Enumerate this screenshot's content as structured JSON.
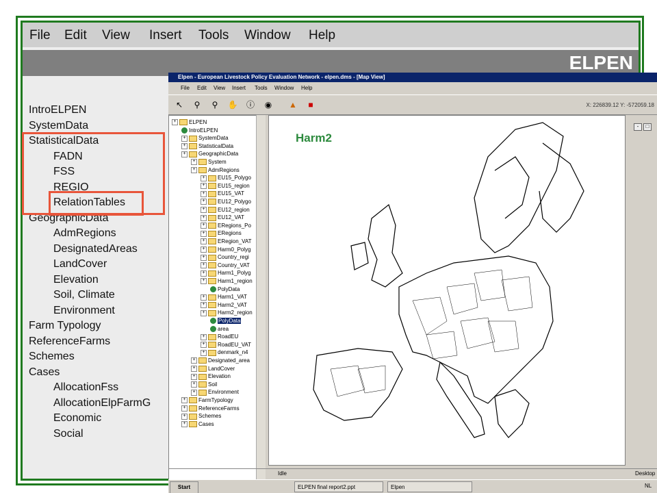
{
  "menubar": {
    "items": [
      "File",
      "Edit",
      "View",
      "Insert",
      "Tools",
      "Window",
      "Help"
    ]
  },
  "header": {
    "brand": "ELPEN"
  },
  "outline": {
    "items": [
      {
        "label": "IntroELPEN",
        "indent": 0
      },
      {
        "label": "SystemData",
        "indent": 0
      },
      {
        "label": "StatisticalData",
        "indent": 0
      },
      {
        "label": "FADN",
        "indent": 1
      },
      {
        "label": "FSS",
        "indent": 1
      },
      {
        "label": "REGIO",
        "indent": 1
      },
      {
        "label": "RelationTables",
        "indent": 1
      },
      {
        "label": "GeographicData",
        "indent": 0
      },
      {
        "label": "AdmRegions",
        "indent": 1
      },
      {
        "label": "DesignatedAreas",
        "indent": 1
      },
      {
        "label": "LandCover",
        "indent": 1
      },
      {
        "label": "Elevation",
        "indent": 1
      },
      {
        "label": "Soil, Climate",
        "indent": 1
      },
      {
        "label": "Environment",
        "indent": 1
      },
      {
        "label": "Farm Typology",
        "indent": 0
      },
      {
        "label": "ReferenceFarms",
        "indent": 0
      },
      {
        "label": "Schemes",
        "indent": 0
      },
      {
        "label": "Cases",
        "indent": 0
      },
      {
        "label": "AllocationFss",
        "indent": 1
      },
      {
        "label": "AllocationElpFarmG",
        "indent": 1
      },
      {
        "label": "Economic",
        "indent": 1
      },
      {
        "label": "Social",
        "indent": 1
      }
    ]
  },
  "app": {
    "title": "Elpen - European Livestock Policy Evaluation Network - elpen.dms - [Map View]",
    "menu": [
      "File",
      "Edit",
      "View",
      "Insert",
      "Tools",
      "Window",
      "Help"
    ],
    "coords": "X: 226839.12  Y: -572059.18",
    "map_label": "Harm2",
    "status": "Idle",
    "status_right": "Desktop",
    "tree": [
      {
        "label": "ELPEN",
        "lvl": 0,
        "kind": "folder"
      },
      {
        "label": "IntroELPEN",
        "lvl": 1,
        "kind": "globe"
      },
      {
        "label": "SystemData",
        "lvl": 1,
        "kind": "folder"
      },
      {
        "label": "StatisticalData",
        "lvl": 1,
        "kind": "folder"
      },
      {
        "label": "GeographicData",
        "lvl": 1,
        "kind": "folder"
      },
      {
        "label": "System",
        "lvl": 2,
        "kind": "folder"
      },
      {
        "label": "AdmRegions",
        "lvl": 2,
        "kind": "folder"
      },
      {
        "label": "EU15_Polygo",
        "lvl": 3,
        "kind": "folder"
      },
      {
        "label": "EU15_region",
        "lvl": 3,
        "kind": "folder"
      },
      {
        "label": "EU15_VAT",
        "lvl": 3,
        "kind": "folder"
      },
      {
        "label": "EU12_Polygo",
        "lvl": 3,
        "kind": "folder"
      },
      {
        "label": "EU12_region",
        "lvl": 3,
        "kind": "folder"
      },
      {
        "label": "EU12_VAT",
        "lvl": 3,
        "kind": "folder"
      },
      {
        "label": "ERegions_Po",
        "lvl": 3,
        "kind": "folder"
      },
      {
        "label": "ERegions",
        "lvl": 3,
        "kind": "folder"
      },
      {
        "label": "ERegion_VAT",
        "lvl": 3,
        "kind": "folder"
      },
      {
        "label": "Harm0_Polyg",
        "lvl": 3,
        "kind": "folder"
      },
      {
        "label": "Country_regi",
        "lvl": 3,
        "kind": "folder"
      },
      {
        "label": "Country_VAT",
        "lvl": 3,
        "kind": "folder"
      },
      {
        "label": "Harm1_Polyg",
        "lvl": 3,
        "kind": "folder"
      },
      {
        "label": "Harm1_region",
        "lvl": 3,
        "kind": "folder"
      },
      {
        "label": "PolyData",
        "lvl": 4,
        "kind": "globe"
      },
      {
        "label": "Harm1_VAT",
        "lvl": 3,
        "kind": "folder"
      },
      {
        "label": "Harm2_VAT",
        "lvl": 3,
        "kind": "folder"
      },
      {
        "label": "Harm2_region",
        "lvl": 3,
        "kind": "folder"
      },
      {
        "label": "PolyData",
        "lvl": 4,
        "kind": "globe",
        "selected": true
      },
      {
        "label": "area",
        "lvl": 4,
        "kind": "globe"
      },
      {
        "label": "RoadEU",
        "lvl": 3,
        "kind": "folder"
      },
      {
        "label": "RoadEU_VAT",
        "lvl": 3,
        "kind": "folder"
      },
      {
        "label": "denmark_n4",
        "lvl": 3,
        "kind": "folder"
      },
      {
        "label": "Designated_area",
        "lvl": 2,
        "kind": "folder"
      },
      {
        "label": "LandCover",
        "lvl": 2,
        "kind": "folder"
      },
      {
        "label": "Elevation",
        "lvl": 2,
        "kind": "folder"
      },
      {
        "label": "Soil",
        "lvl": 2,
        "kind": "folder"
      },
      {
        "label": "Environment",
        "lvl": 2,
        "kind": "folder"
      },
      {
        "label": "FarmTypology",
        "lvl": 1,
        "kind": "folder"
      },
      {
        "label": "ReferenceFarms",
        "lvl": 1,
        "kind": "folder"
      },
      {
        "label": "Schemes",
        "lvl": 1,
        "kind": "folder"
      },
      {
        "label": "Cases",
        "lvl": 1,
        "kind": "folder"
      }
    ],
    "taskbar": {
      "start": "Start",
      "items": [
        "ELPEN final report2.ppt",
        "Elpen"
      ],
      "tray": "NL"
    }
  },
  "colors": {
    "frame": "#1f7a1f",
    "highlight": "#e8553a",
    "map_label": "#2c8a3d"
  }
}
